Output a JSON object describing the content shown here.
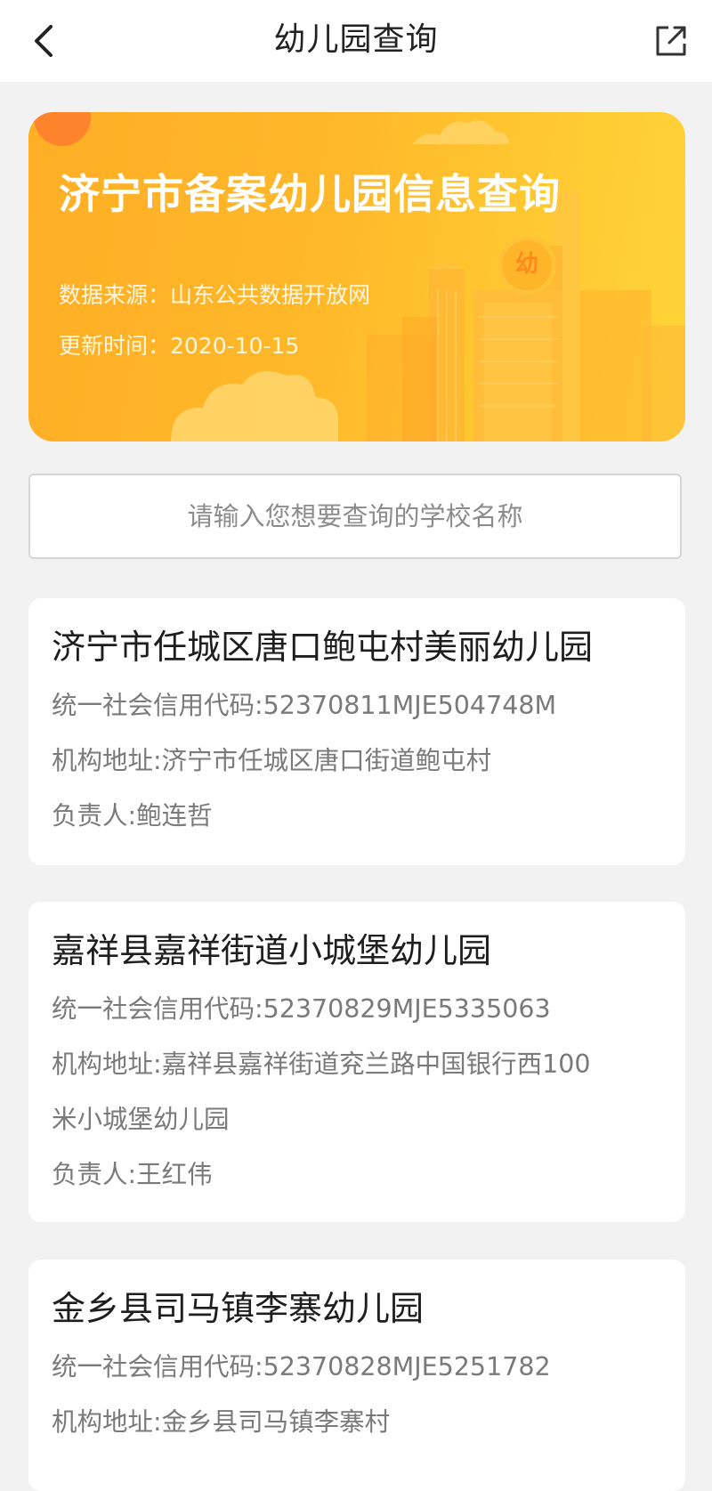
{
  "header": {
    "title": "幼儿园查询",
    "back_icon": "chevron-left-icon",
    "share_icon": "share-external-icon"
  },
  "banner": {
    "title": "济宁市备案幼儿园信息查询",
    "source": "数据来源：山东公共数据开放网",
    "updated": "更新时间：2020-10-15",
    "badge_char": "幼",
    "colors": {
      "gradient_start": "#ffae25",
      "gradient_end": "#ffd43a",
      "sun": "#ff7a2e"
    }
  },
  "search": {
    "placeholder": "请输入您想要查询的学校名称",
    "value": ""
  },
  "kindergartens": [
    {
      "name": "济宁市任城区唐口鲍屯村美丽幼儿园",
      "credit_code": "统一社会信用代码:52370811MJE504748M",
      "address": "机构地址:济宁市任城区唐口街道鲍屯村",
      "principal": "负责人:鲍连哲"
    },
    {
      "name": "嘉祥县嘉祥街道小城堡幼儿园",
      "credit_code": "统一社会信用代码:52370829MJE5335063",
      "address_line1": "机构地址:嘉祥县嘉祥街道兖兰路中国银行西100",
      "address_line2": "米小城堡幼儿园",
      "principal": "负责人:王红伟"
    },
    {
      "name": "金乡县司马镇李寨幼儿园",
      "credit_code": "统一社会信用代码:52370828MJE5251782",
      "address": "机构地址:金乡县司马镇李寨村"
    }
  ]
}
